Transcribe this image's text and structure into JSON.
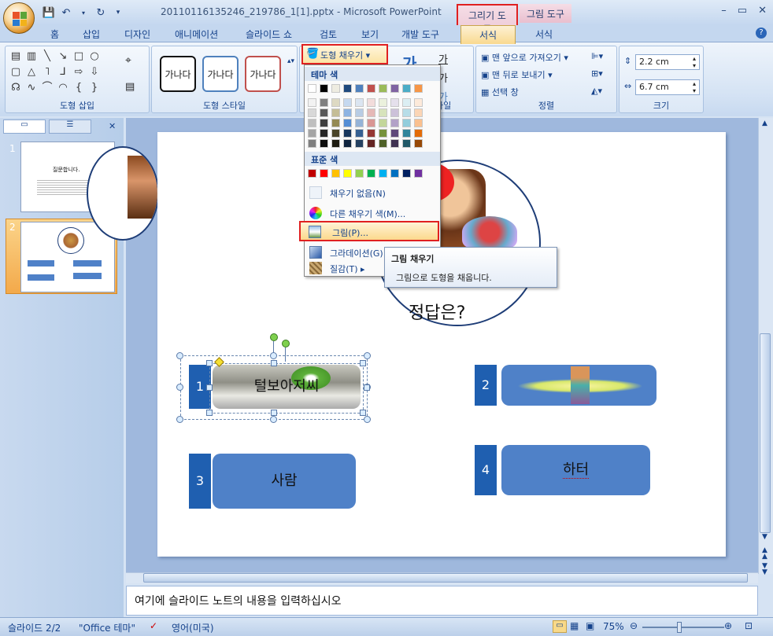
{
  "window": {
    "title": "20110116135246_219786_1[1].pptx - Microsoft PowerPoint",
    "context_tabs": {
      "drawing_tools": "그리기 도구",
      "picture_tools": "그림 도구"
    },
    "controls": [
      "–",
      "▭",
      "✕"
    ]
  },
  "tabs": [
    {
      "label": "홈"
    },
    {
      "label": "삽입"
    },
    {
      "label": "디자인"
    },
    {
      "label": "애니메이션"
    },
    {
      "label": "슬라이드 쇼"
    },
    {
      "label": "검토"
    },
    {
      "label": "보기"
    },
    {
      "label": "개발 도구"
    },
    {
      "label": "서식",
      "active": true
    },
    {
      "label": "서식"
    }
  ],
  "ribbon": {
    "insert_shapes_label": "도형 삽입",
    "shape_styles_label": "도형 스타일",
    "style_sample": "가나다",
    "fill_button": "도형 채우기",
    "wordart_label": "타일",
    "arrange_label": "정렬",
    "bring_front": "맨 앞으로 가져오기",
    "send_back": "맨 뒤로 보내기",
    "selection_pane": "선택 창",
    "size_label": "크기",
    "height": "2.2 cm",
    "width": "6.7 cm"
  },
  "dropdown": {
    "theme_colors": "테마 색",
    "standard_colors": "표준 색",
    "no_fill": "채우기 없음(N)",
    "more_colors": "다른 채우기 색(M)...",
    "picture": "그림(P)...",
    "gradient": "그라데이션(G)",
    "texture": "질감(T)",
    "theme_top": [
      "#ffffff",
      "#000000",
      "#eeece1",
      "#1f497d",
      "#4f81bd",
      "#c0504d",
      "#9bbb59",
      "#8064a2",
      "#4bacc6",
      "#f79646"
    ],
    "theme_shades": [
      [
        "#f2f2f2",
        "#7f7f7f",
        "#ddd9c3",
        "#c6d9f0",
        "#dbe5f1",
        "#f2dcdb",
        "#ebf1dd",
        "#e5e0ec",
        "#dbeef3",
        "#fdeada"
      ],
      [
        "#d8d8d8",
        "#595959",
        "#c4bd97",
        "#8db3e2",
        "#b8cce4",
        "#e5b9b7",
        "#d7e3bc",
        "#ccc1d9",
        "#b7dde8",
        "#fbd5b5"
      ],
      [
        "#bfbfbf",
        "#3f3f3f",
        "#938953",
        "#548dd4",
        "#95b3d7",
        "#d99694",
        "#c3d69b",
        "#b2a2c7",
        "#92cddc",
        "#fac08f"
      ],
      [
        "#a5a5a5",
        "#262626",
        "#494429",
        "#17365d",
        "#366092",
        "#953734",
        "#76923c",
        "#5f497a",
        "#31859b",
        "#e36c09"
      ],
      [
        "#7f7f7f",
        "#0c0c0c",
        "#1d1b10",
        "#0f243e",
        "#244061",
        "#632423",
        "#4f6128",
        "#3f3151",
        "#205867",
        "#974806"
      ]
    ],
    "standard": [
      "#c00000",
      "#ff0000",
      "#ffc000",
      "#ffff00",
      "#92d050",
      "#00b050",
      "#00b0f0",
      "#0070c0",
      "#002060",
      "#7030a0"
    ]
  },
  "tooltip": {
    "title": "그림 채우기",
    "body": "그림으로 도형을 채웁니다."
  },
  "slides_pane": {
    "slide1_num": "1",
    "slide1_title": "질문합니다.",
    "slide2_num": "2"
  },
  "slide": {
    "question": "정답은?",
    "answers": [
      {
        "num": "1",
        "text": "털보아저씨"
      },
      {
        "num": "2",
        "text": ""
      },
      {
        "num": "3",
        "text": "사람"
      },
      {
        "num": "4",
        "text": "하터"
      }
    ]
  },
  "notes": {
    "placeholder": "여기에 슬라이드 노트의 내용을 입력하십시오"
  },
  "status": {
    "slide": "슬라이드 2/2",
    "theme": "\"Office 테마\"",
    "language": "영어(미국)",
    "zoom": "75%"
  }
}
